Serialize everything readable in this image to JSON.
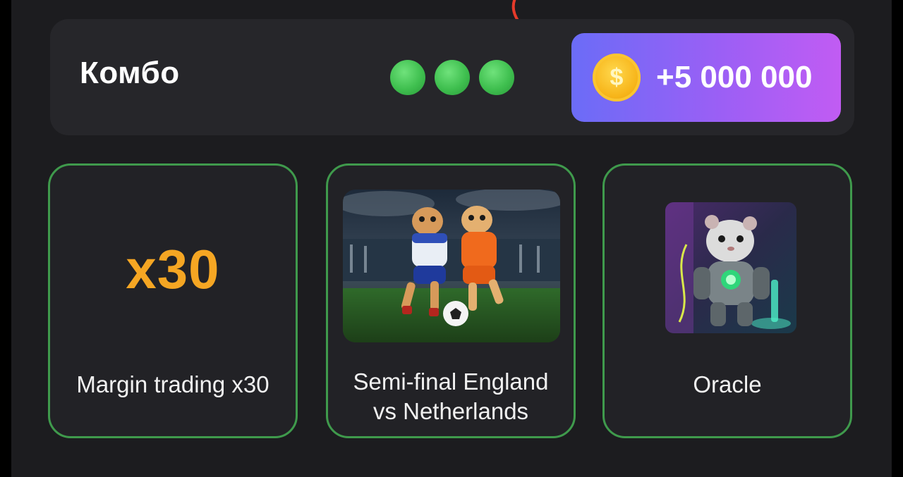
{
  "combo": {
    "title": "Комбо",
    "found_count": 3,
    "reward_amount": "+5 000 000",
    "dot_color": "#3fbf4f"
  },
  "cards": [
    {
      "multiplier": "x30",
      "label": "Margin trading x30",
      "image": "multiplier-text"
    },
    {
      "label_line1": "Semi-final England",
      "label_line2": "vs Netherlands",
      "image": "hamsters-playing-football"
    },
    {
      "label": "Oracle",
      "image": "cyborg-hamster"
    }
  ],
  "colors": {
    "background": "#1c1c1f",
    "panel": "#26262a",
    "card_border": "#3f9a4c",
    "multiplier": "#f5a623",
    "reward_gradient_start": "#6b6cf7",
    "reward_gradient_end": "#c15cf3"
  }
}
